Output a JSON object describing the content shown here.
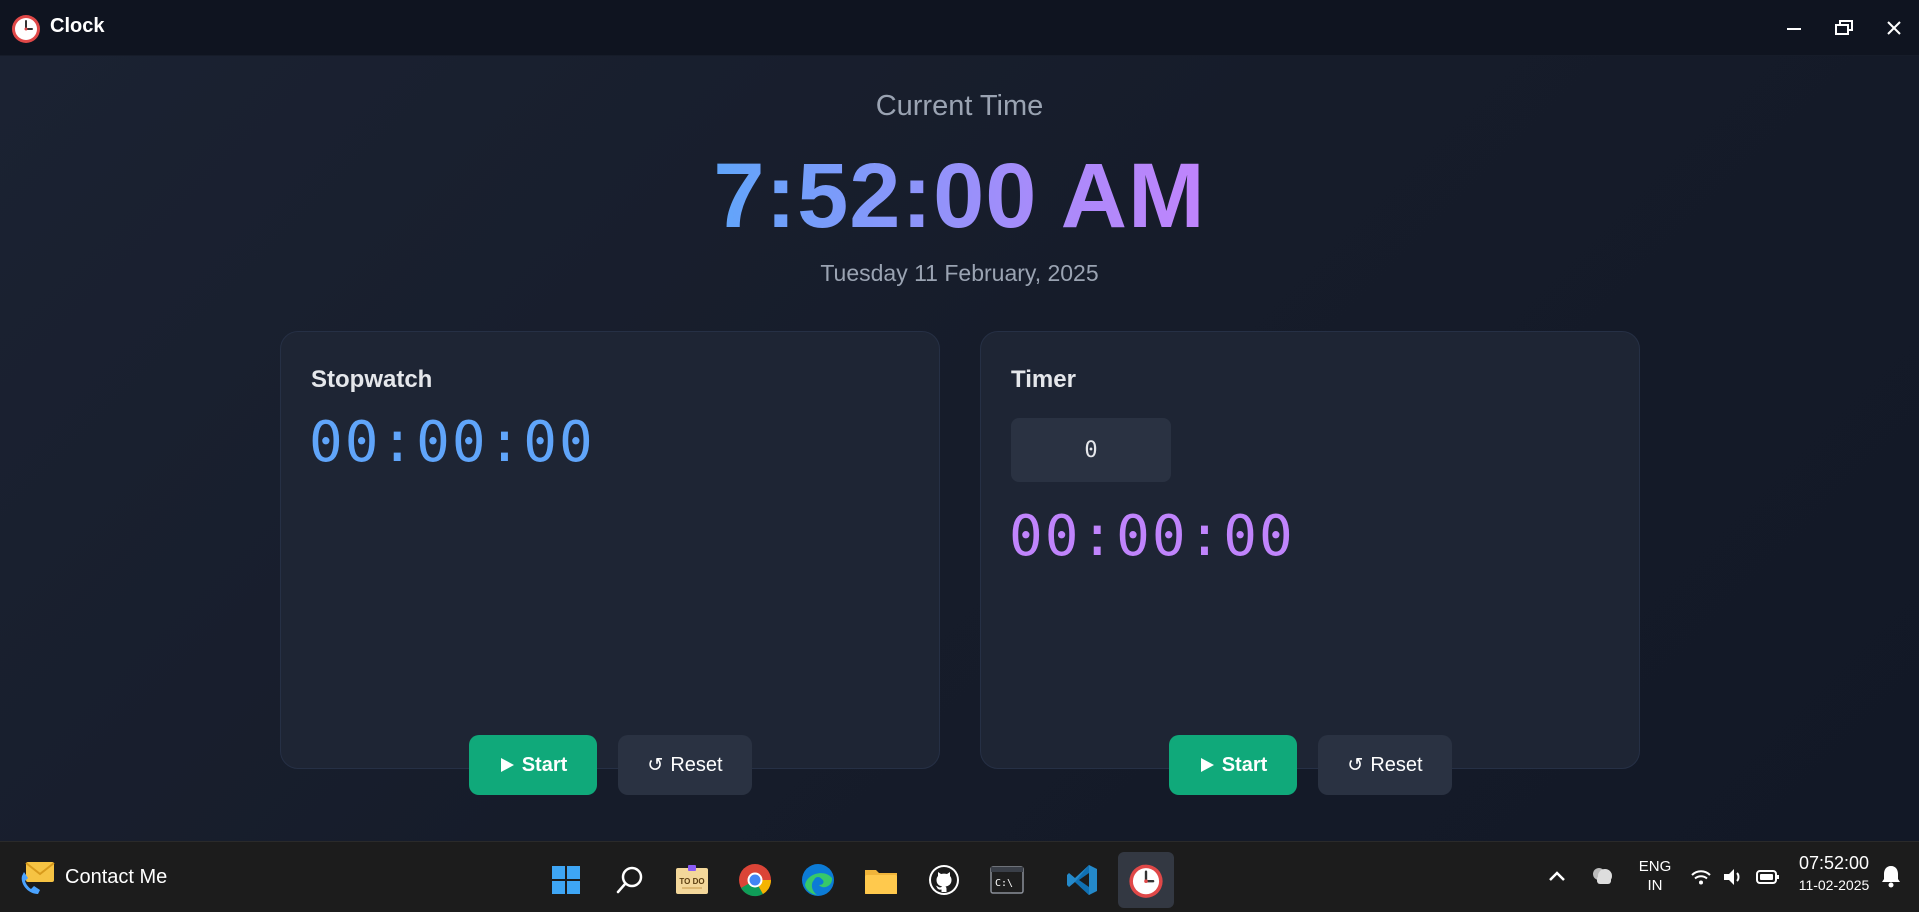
{
  "window": {
    "title": "Clock",
    "icon": "alarm-clock-icon",
    "controls": [
      "minimize-icon",
      "restore-icon",
      "close-icon"
    ]
  },
  "clock": {
    "label": "Current Time",
    "time": "7:52:00 AM",
    "date": "Tuesday 11 February, 2025"
  },
  "stopwatch": {
    "title": "Stopwatch",
    "display": "00:00:00",
    "start_label": "Start",
    "reset_label": "Reset"
  },
  "timer": {
    "title": "Timer",
    "input_value": "0",
    "display": "00:00:00",
    "start_label": "Start",
    "reset_label": "Reset"
  },
  "colors": {
    "accent_blue": "#60a5fa",
    "accent_purple": "#c084fc",
    "start_green": "#10a97a"
  },
  "taskbar": {
    "contact_label": "Contact Me",
    "apps": [
      "windows-start-icon",
      "search-icon",
      "todo-icon",
      "chrome-icon",
      "edge-icon",
      "file-explorer-icon",
      "github-icon",
      "terminal-icon",
      "vscode-icon",
      "clock-app-icon"
    ],
    "language_line1": "ENG",
    "language_line2": "IN",
    "clock_time": "07:52:00",
    "clock_date": "11-02-2025"
  }
}
